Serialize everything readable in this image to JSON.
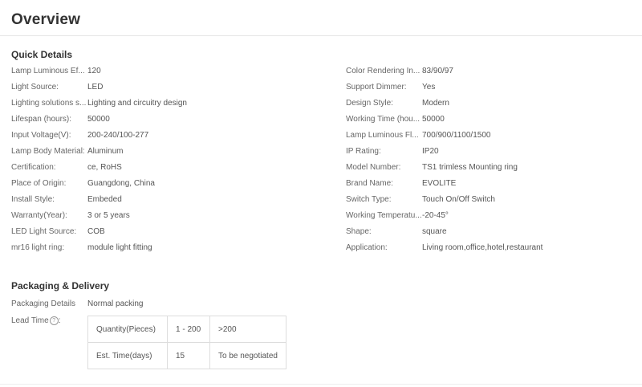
{
  "page_title": "Overview",
  "quick_details": {
    "title": "Quick Details",
    "left": [
      {
        "label": "Lamp Luminous Ef...",
        "value": "120"
      },
      {
        "label": "Light Source:",
        "value": "LED"
      },
      {
        "label": "Lighting solutions s...",
        "value": "Lighting and circuitry design"
      },
      {
        "label": "Lifespan (hours):",
        "value": "50000"
      },
      {
        "label": "Input Voltage(V):",
        "value": "200-240/100-277"
      },
      {
        "label": "Lamp Body Material:",
        "value": "Aluminum"
      },
      {
        "label": "Certification:",
        "value": "ce, RoHS"
      },
      {
        "label": "Place of Origin:",
        "value": "Guangdong, China"
      },
      {
        "label": "Install Style:",
        "value": "Embeded"
      },
      {
        "label": "Warranty(Year):",
        "value": "3 or 5 years"
      },
      {
        "label": "LED Light Source:",
        "value": "COB"
      },
      {
        "label": "mr16 light ring:",
        "value": "module light fitting"
      }
    ],
    "right": [
      {
        "label": "Color Rendering In...",
        "value": "83/90/97"
      },
      {
        "label": "Support Dimmer:",
        "value": "Yes"
      },
      {
        "label": "Design Style:",
        "value": "Modern"
      },
      {
        "label": "Working Time (hou...",
        "value": "50000"
      },
      {
        "label": "Lamp Luminous Fl...",
        "value": "700/900/1100/1500"
      },
      {
        "label": "IP Rating:",
        "value": "IP20"
      },
      {
        "label": "Model Number:",
        "value": "TS1 trimless Mounting ring"
      },
      {
        "label": "Brand Name:",
        "value": "EVOLITE"
      },
      {
        "label": "Switch Type:",
        "value": "Touch On/Off Switch"
      },
      {
        "label": "Working Temperatu...",
        "value": "-20-45°"
      },
      {
        "label": "Shape:",
        "value": "square"
      },
      {
        "label": "Application:",
        "value": "Living room,office,hotel,restaurant"
      }
    ]
  },
  "packaging": {
    "title": "Packaging & Delivery",
    "details_label": "Packaging Details",
    "details_value": "Normal packing",
    "lead_time_label": "Lead Time",
    "help_icon": "?",
    "lead_table": [
      [
        "Quantity(Pieces)",
        "1 - 200",
        ">200"
      ],
      [
        "Est. Time(days)",
        "15",
        "To be negotiated"
      ]
    ]
  }
}
